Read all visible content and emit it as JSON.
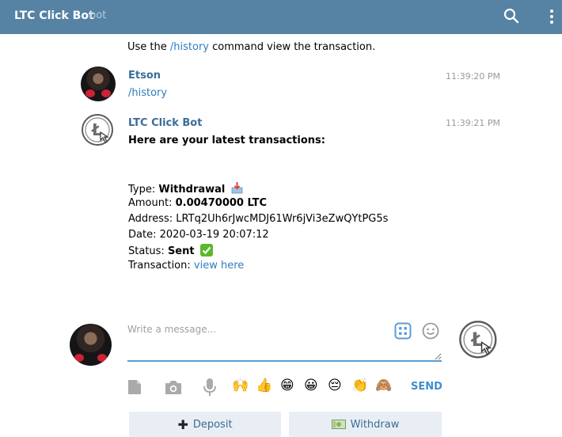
{
  "header": {
    "title": "LTC Click Bot",
    "subtitle": "bot"
  },
  "messages": {
    "top_line": {
      "prefix": "Use the ",
      "command": "/history",
      "suffix": " command view the transaction."
    },
    "user_msg": {
      "sender": "Etson",
      "time": "11:39:20 PM",
      "text": "/history"
    },
    "bot_msg": {
      "sender": "LTC Click Bot",
      "time": "11:39:21 PM",
      "heading": "Here are your latest transactions:",
      "type_label": "Type: ",
      "type_value": "Withdrawal",
      "amount_label": "Amount: ",
      "amount_value": "0.00470000 LTC",
      "address_label": "Address: ",
      "address_value": "LRTq2Uh6rJwcMDJ61Wr6jVi3eZwQYtPG5s",
      "date_label": "Date: ",
      "date_value": "2020-03-19 20:07:12",
      "status_label": "Status: ",
      "status_value": "Sent",
      "tx_label": "Transaction: ",
      "tx_link": "view here"
    }
  },
  "composer": {
    "placeholder": "Write a message...",
    "send_label": "SEND",
    "emojis": [
      "🙌",
      "👍",
      "😁",
      "😀",
      "😔",
      "👏",
      "🙈"
    ]
  },
  "keyboard": {
    "deposit_label": "Deposit",
    "withdraw_label": "Withdraw"
  },
  "colors": {
    "header_bg": "#5682a3",
    "sender": "#3a6d99",
    "link": "#2f7bbf",
    "accent": "#3e8fd1"
  }
}
